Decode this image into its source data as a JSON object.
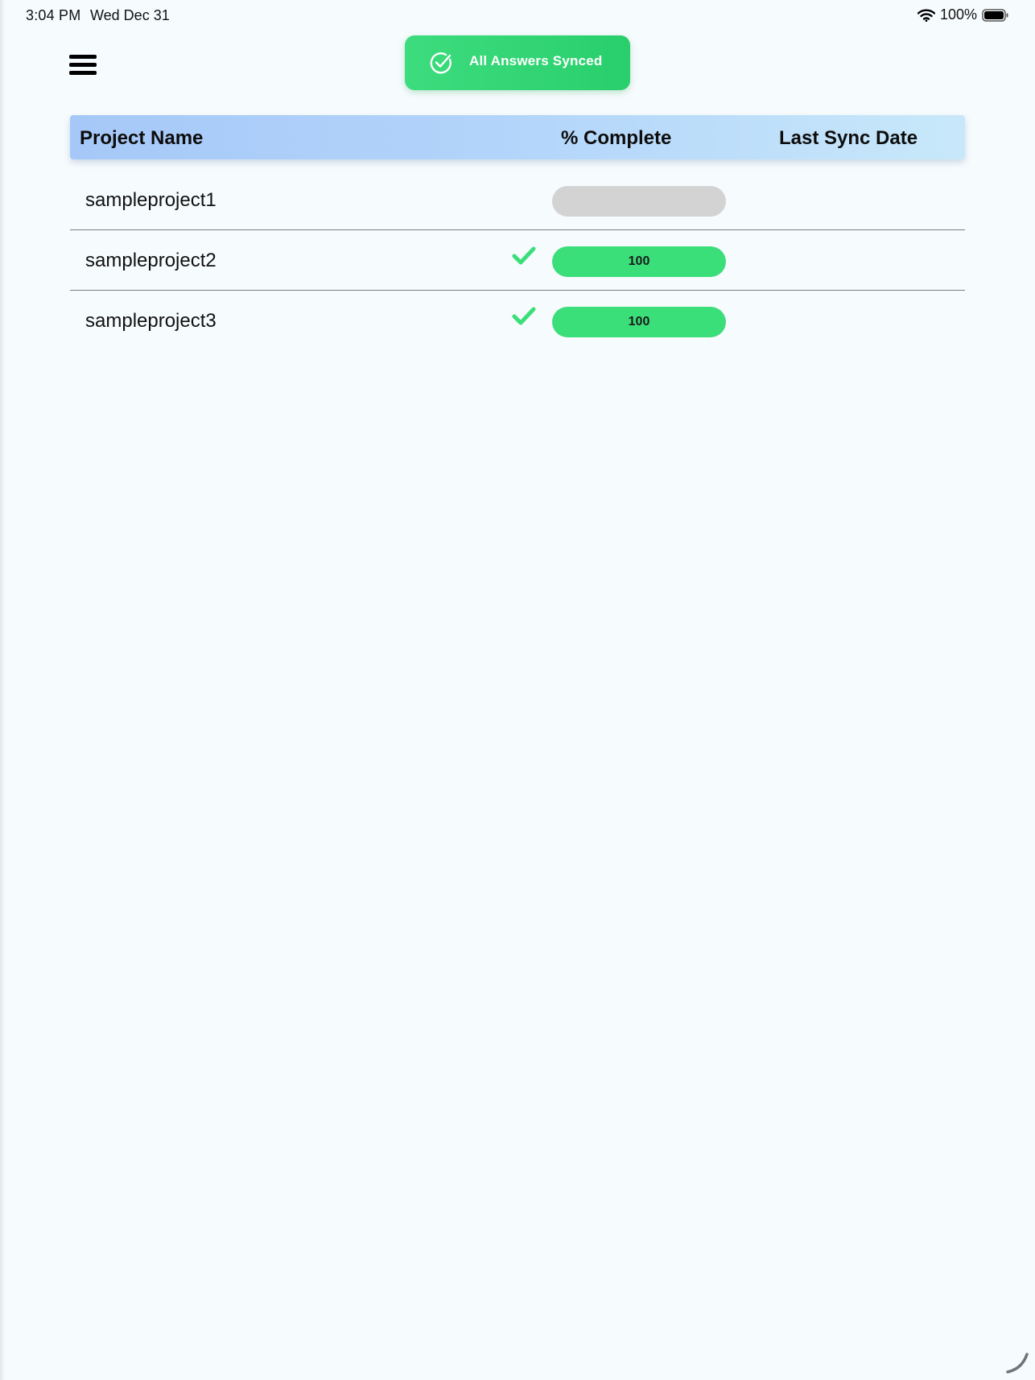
{
  "status_bar": {
    "time": "3:04 PM",
    "date": "Wed Dec 31",
    "battery": "100%"
  },
  "sync_button": {
    "label": "All Answers Synced",
    "icon": "circle-check-icon"
  },
  "table": {
    "headers": {
      "project_name": "Project Name",
      "percent_complete": "% Complete",
      "last_sync_date": "Last Sync Date"
    },
    "rows": [
      {
        "name": "sampleproject1",
        "synced": false,
        "progress": 0,
        "progress_label": "",
        "last_sync": ""
      },
      {
        "name": "sampleproject2",
        "synced": true,
        "progress": 100,
        "progress_label": "100",
        "last_sync": ""
      },
      {
        "name": "sampleproject3",
        "synced": true,
        "progress": 100,
        "progress_label": "100",
        "last_sync": ""
      }
    ]
  },
  "colors": {
    "accent_green": "#3adf7a",
    "header_blue": "#a6c8f8",
    "track_gray": "#d3d3d3"
  }
}
